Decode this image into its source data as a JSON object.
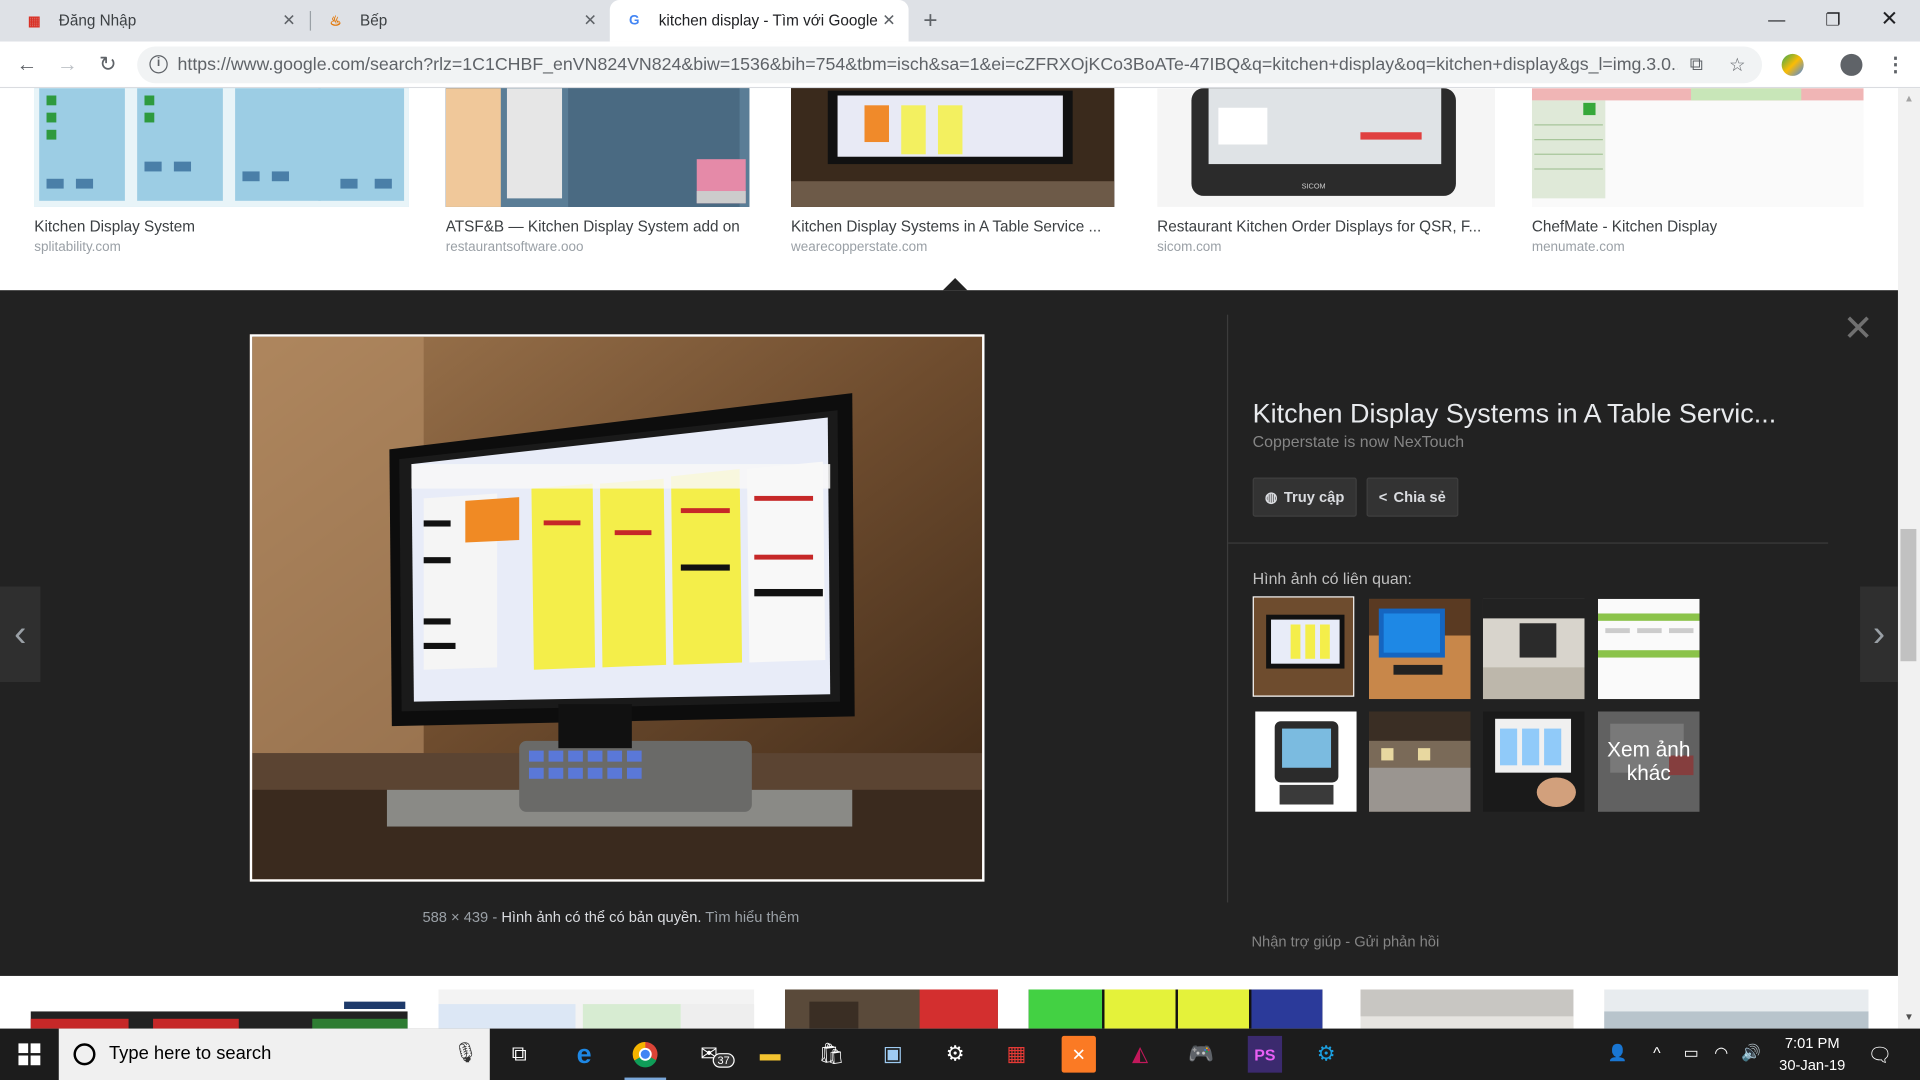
{
  "browser": {
    "tabs": [
      {
        "title": "Đăng Nhập",
        "icon": "app-icon"
      },
      {
        "title": "Bếp",
        "icon": "chef-icon"
      },
      {
        "title": "kitchen display - Tìm với Google",
        "icon": "google-icon"
      }
    ],
    "url": "https://www.google.com/search?rlz=1C1CHBF_enVN824VN824&biw=1536&bih=754&tbm=isch&sa=1&ei=cZFRXOjKCo3BoATe-47IBQ&q=kitchen+display&oq=kitchen+display&gs_l=img.3.0..."
  },
  "results_top": [
    {
      "caption": "Kitchen Display System",
      "source": "splitability.com"
    },
    {
      "caption": "ATSF&B — Kitchen Display System add on",
      "source": "restaurantsoftware.ooo"
    },
    {
      "caption": "Kitchen Display Systems in A Table Service ...",
      "source": "wearecopperstate.com"
    },
    {
      "caption": "Restaurant Kitchen Order Displays for QSR, F...",
      "source": "sicom.com"
    },
    {
      "caption": "ChefMate - Kitchen Display",
      "source": "menumate.com"
    }
  ],
  "panel": {
    "title": "Kitchen Display Systems in A Table Servic...",
    "subtitle": "Copperstate is now NexTouch",
    "visit_button": "Truy cập",
    "share_button": "Chia sẻ",
    "related_label": "Hình ảnh có liên quan:",
    "more_label": "Xem ảnh khác",
    "dimensions": "588 × 439",
    "copyright_text": "Hình ảnh có thể có bản quyền.",
    "learn_more": "Tìm hiểu thêm",
    "help": "Nhận trợ giúp",
    "feedback": "Gửi phản hồi",
    "separator": "-"
  },
  "taskbar": {
    "search_placeholder": "Type here to search",
    "mail_badge": "37",
    "time": "7:01 PM",
    "date": "30-Jan-19"
  },
  "colors": {
    "panel_bg": "#222222",
    "taskbar_bg": "#1c1c1c",
    "tab_strip": "#dee1e6"
  }
}
